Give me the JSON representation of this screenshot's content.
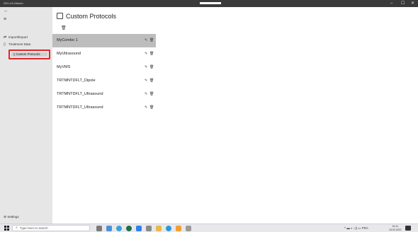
{
  "window": {
    "title": "DIO-UX-Meerlo",
    "minimize": "–",
    "maximize": "☐",
    "close": "✕"
  },
  "sidebar": {
    "back_icon": "←",
    "menu_icon": "≡",
    "items": [
      {
        "label": "Import/Export",
        "icon": "import-export-icon",
        "glyph": "⇄"
      },
      {
        "label": "Treatment Data",
        "icon": "document-icon",
        "glyph": "▯"
      },
      {
        "label": "Custom Protocols",
        "icon": "protocol-icon",
        "glyph": "▯"
      }
    ],
    "selected_index": 2,
    "settings_label": "Settings",
    "settings_glyph": "⚙"
  },
  "main": {
    "title": "Custom Protocols",
    "add_icon_glyph": "🗑",
    "protocols": [
      {
        "name": "MyCombo 1",
        "selected": true
      },
      {
        "name": "MyUltrasound",
        "selected": false
      },
      {
        "name": "MyVMS",
        "selected": false
      },
      {
        "name": "TRTMNTDFLT_Dipole",
        "selected": false
      },
      {
        "name": "TRTMNTDFLT_Ultrasound",
        "selected": false
      },
      {
        "name": "TRTMNTDFLT_Ultrasound",
        "selected": false
      }
    ],
    "edit_glyph": "✎",
    "delete_glyph": "🗑"
  },
  "taskbar": {
    "search_placeholder": "Type here to search",
    "search_glyph": "⌕",
    "tray_text": "^ ▬ ◐ ◁) ▭ FRA",
    "clock_time": "10:11",
    "clock_date": "15.02.2022"
  },
  "colors": {
    "sidebar_bg": "#e6e6e6",
    "selected_row": "#bdbdbd",
    "highlight_border": "#e0262f",
    "titlebar_bg": "#3a3a3a"
  }
}
